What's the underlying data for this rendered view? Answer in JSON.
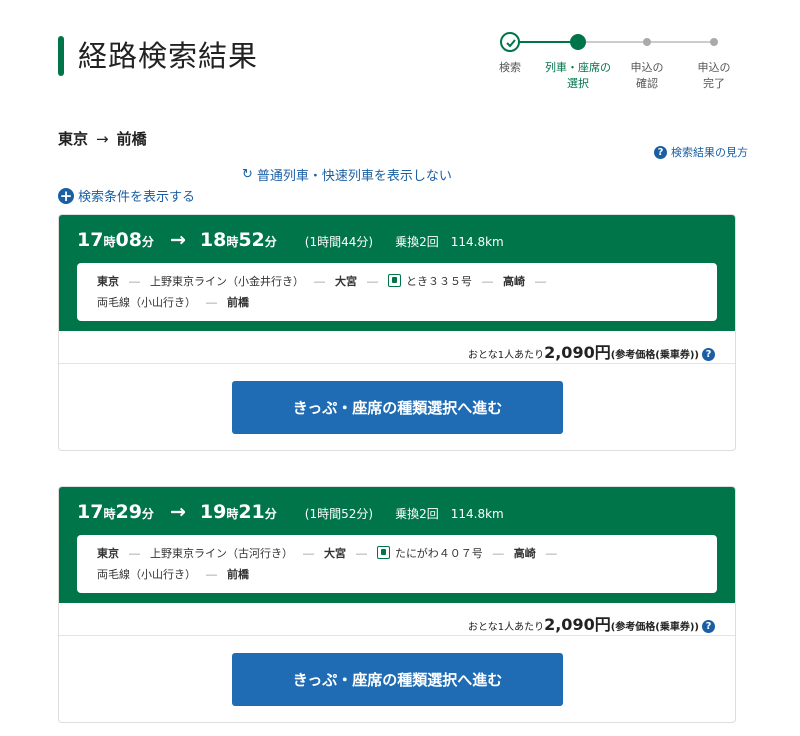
{
  "page_title": "経路検索結果",
  "stepper": [
    {
      "label": "検索",
      "state": "done"
    },
    {
      "label": "列車・座席の\n選択",
      "state": "active"
    },
    {
      "label": "申込の\n確認",
      "state": "todo"
    },
    {
      "label": "申込の\n完了",
      "state": "todo"
    }
  ],
  "route": {
    "from": "東京",
    "arrow": "→",
    "to": "前橋"
  },
  "help_link": "検索結果の見方",
  "toggle_link": "普通列車・快速列車を表示しない",
  "search_conditions_link": "検索条件を表示する",
  "colors": {
    "brand_green": "#00754a",
    "button_blue": "#1f6cb5",
    "link_blue": "#1a5fa3"
  },
  "results": [
    {
      "dep_h": "17",
      "dep_m": "08",
      "arr_h": "18",
      "arr_m": "52",
      "h_unit": "時",
      "m_unit": "分",
      "arrow": "→",
      "duration": "(1時間44分)",
      "transfers": "乗換2回",
      "distance": "114.8km",
      "stations": {
        "s1": "東京",
        "s2": "大宮",
        "s3": "高崎",
        "s4": "前橋"
      },
      "lines": {
        "l1": "上野東京ライン（小金井行き）",
        "l2": "とき３３５号",
        "l3": "両毛線（小山行き）"
      },
      "dash": "―",
      "price_prefix": "おとな1人あたり",
      "price": "2,090円",
      "price_note": "(参考価格(乗車券))",
      "button": "きっぷ・座席の種類選択へ進む"
    },
    {
      "dep_h": "17",
      "dep_m": "29",
      "arr_h": "19",
      "arr_m": "21",
      "h_unit": "時",
      "m_unit": "分",
      "arrow": "→",
      "duration": "(1時間52分)",
      "transfers": "乗換2回",
      "distance": "114.8km",
      "stations": {
        "s1": "東京",
        "s2": "大宮",
        "s3": "高崎",
        "s4": "前橋"
      },
      "lines": {
        "l1": "上野東京ライン（古河行き）",
        "l2": "たにがわ４０７号",
        "l3": "両毛線（小山行き）"
      },
      "dash": "―",
      "price_prefix": "おとな1人あたり",
      "price": "2,090円",
      "price_note": "(参考価格(乗車券))",
      "button": "きっぷ・座席の種類選択へ進む"
    }
  ]
}
